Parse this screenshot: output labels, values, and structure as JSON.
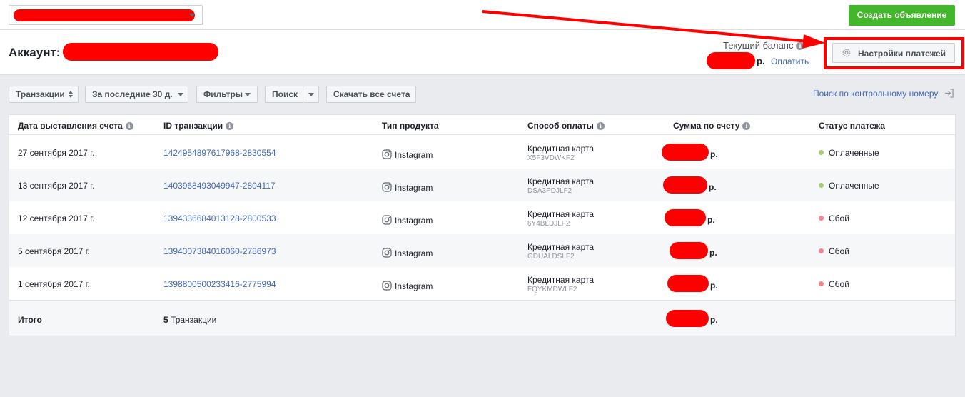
{
  "topbar": {
    "create_label": "Создать объявление"
  },
  "header": {
    "account_label": "Аккаунт:",
    "balance_label": "Текущий баланс",
    "balance_currency": "р.",
    "pay_link": "Оплатить",
    "payment_settings_label": "Настройки платежей"
  },
  "toolbar": {
    "transactions_label": "Транзакции",
    "period_label": "За последние 30 д.",
    "filters_label": "Фильтры",
    "search_label": "Поиск",
    "download_label": "Скачать все счета",
    "search_by_number_label": "Поиск по контрольному номеру"
  },
  "table": {
    "headers": {
      "date": "Дата выставления счета",
      "txid": "ID транзакции",
      "product": "Тип продукта",
      "payment": "Способ оплаты",
      "amount": "Сумма по счету",
      "status": "Статус платежа"
    },
    "rows": [
      {
        "date": "27 сентября 2017 г.",
        "txid": "1424954897617968-2830554",
        "product": "Instagram",
        "pay_type": "Кредитная карта",
        "pay_code": "X5F3VDWKF2",
        "currency": "р.",
        "status": "Оплаченные",
        "status_color": "#a3ce71"
      },
      {
        "date": "13 сентября 2017 г.",
        "txid": "1403968493049947-2804117",
        "product": "Instagram",
        "pay_type": "Кредитная карта",
        "pay_code": "DSA3PDJLF2",
        "currency": "р.",
        "status": "Оплаченные",
        "status_color": "#a3ce71"
      },
      {
        "date": "12 сентября 2017 г.",
        "txid": "1394336684013128-2800533",
        "product": "Instagram",
        "pay_type": "Кредитная карта",
        "pay_code": "6Y4BLDJLF2",
        "currency": "р.",
        "status": "Сбой",
        "status_color": "#f7838e"
      },
      {
        "date": "5 сентября 2017 г.",
        "txid": "1394307384016060-2786973",
        "product": "Instagram",
        "pay_type": "Кредитная карта",
        "pay_code": "GDUALDSLF2",
        "currency": "р.",
        "status": "Сбой",
        "status_color": "#f7838e"
      },
      {
        "date": "1 сентября 2017 г.",
        "txid": "1398800500233416-2775994",
        "product": "Instagram",
        "pay_type": "Кредитная карта",
        "pay_code": "FQYKMDWLF2",
        "currency": "р.",
        "status": "Сбой",
        "status_color": "#f7838e"
      }
    ],
    "total": {
      "label": "Итого",
      "count": "5",
      "count_suffix": "Транзакции",
      "currency": "р."
    }
  },
  "colors": {
    "accent_green": "#42b72a",
    "link_blue": "#4267b2",
    "annotation_red": "#ff0000"
  },
  "icons": [
    "chevron-down-icon",
    "info-icon",
    "gear-icon",
    "sort-icon",
    "instagram-icon",
    "exit-icon",
    "status-dot"
  ]
}
